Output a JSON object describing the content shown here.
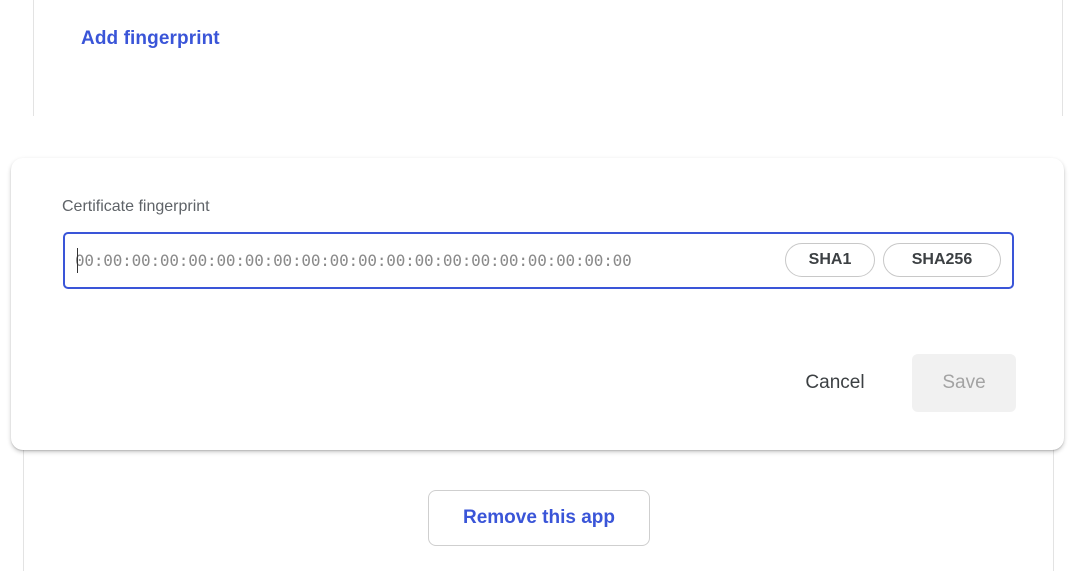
{
  "top_card": {
    "add_fingerprint_label": "Add fingerprint"
  },
  "editor": {
    "field_label": "Certificate fingerprint",
    "fingerprint_input": {
      "value": "",
      "placeholder": "00:00:00:00:00:00:00:00:00:00:00:00:00:00:00:00:00:00:00:00"
    },
    "chips": {
      "sha1_label": "SHA1",
      "sha256_label": "SHA256"
    },
    "cancel_label": "Cancel",
    "save_label": "Save",
    "save_enabled": false
  },
  "bottom_card": {
    "remove_app_label": "Remove this app"
  },
  "colors": {
    "accent": "#3a55d8",
    "text_muted": "#5f6368",
    "disabled_bg": "#f1f1f1",
    "disabled_text": "#a3a3a3"
  }
}
